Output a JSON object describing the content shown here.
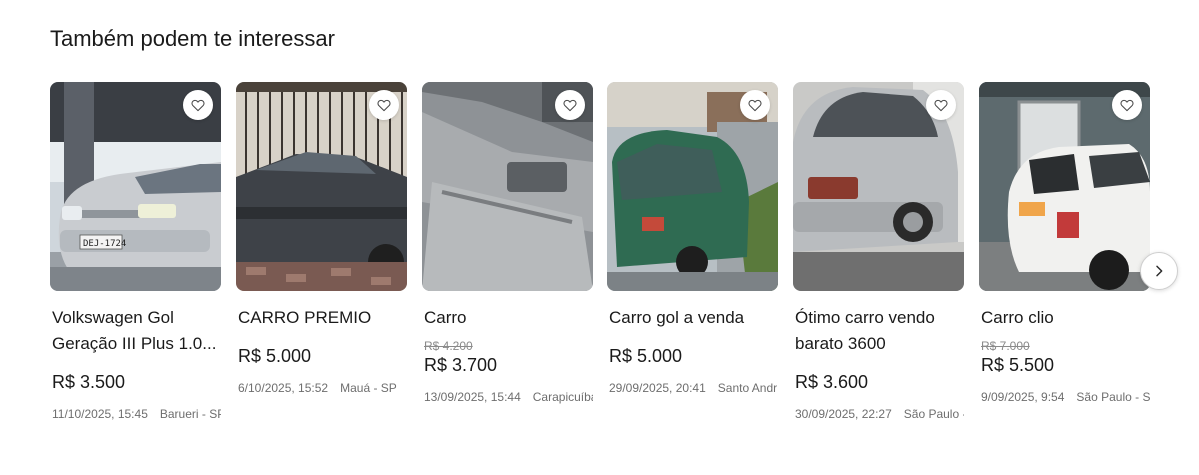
{
  "section": {
    "title": "Também podem te interessar"
  },
  "colors": {
    "text": "#1a1a1a",
    "muted": "#6e6e6e",
    "strike": "#8a8a8a"
  },
  "icons": {
    "favorite": "heart-outline-icon",
    "next": "chevron-right-icon"
  },
  "listings": [
    {
      "title": "Volkswagen Gol Geração III Plus 1.0...",
      "old_price": "",
      "price": "R$ 3.500",
      "date": "11/10/2025, 15:45",
      "location": "Barueri - SP",
      "image": "silver-car-front"
    },
    {
      "title": "CARRO PREMIO",
      "old_price": "",
      "price": "R$ 5.000",
      "date": "6/10/2025, 15:52",
      "location": "Mauá - SP",
      "image": "dark-car-garage"
    },
    {
      "title": "Carro",
      "old_price": "R$ 4.200",
      "price": "R$ 3.700",
      "date": "13/09/2025, 15:44",
      "location": "Carapicuíba",
      "image": "car-interior-panel"
    },
    {
      "title": "Carro gol a venda",
      "old_price": "",
      "price": "R$ 5.000",
      "date": "29/09/2025, 20:41",
      "location": "Santo Andr",
      "image": "green-car-street"
    },
    {
      "title": "Ótimo carro vendo barato 3600",
      "old_price": "",
      "price": "R$ 3.600",
      "date": "30/09/2025, 22:27",
      "location": "São Paulo -",
      "image": "silver-sedan-rear"
    },
    {
      "title": "Carro clio",
      "old_price": "R$ 7.000",
      "price": "R$ 5.500",
      "date": "9/09/2025, 9:54",
      "location": "São Paulo - SP",
      "image": "white-hatch-rear"
    }
  ]
}
